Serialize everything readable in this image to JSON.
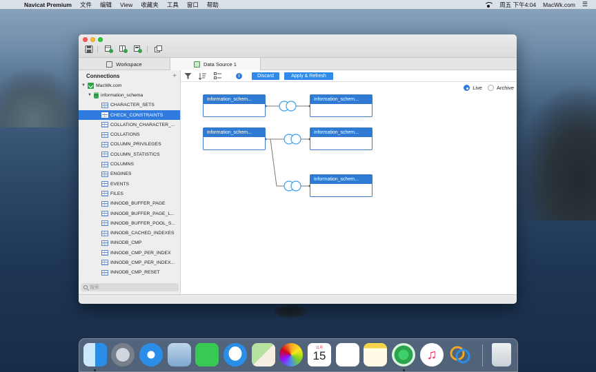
{
  "menubar": {
    "app_name": "Navicat Premium",
    "menus": [
      "文件",
      "编辑",
      "View",
      "收藏夹",
      "工具",
      "窗口",
      "帮助"
    ],
    "clock": "周五 下午4:04",
    "user": "MacWk.com"
  },
  "window": {
    "tabs": [
      {
        "label": "Workspace"
      },
      {
        "label": "Data Source 1"
      }
    ]
  },
  "sidebar": {
    "header": "Connections",
    "connection": "MacWk.com",
    "schema": "information_schema",
    "tables": [
      "CHARACTER_SETS",
      "CHECK_CONSTRAINTS",
      "COLLATION_CHARACTER_...",
      "COLLATIONS",
      "COLUMN_PRIVILEGES",
      "COLUMN_STATISTICS",
      "COLUMNS",
      "ENGINES",
      "EVENTS",
      "FILES",
      "INNODB_BUFFER_PAGE",
      "INNODB_BUFFER_PAGE_L...",
      "INNODB_BUFFER_POOL_S...",
      "INNODB_CACHED_INDEXES",
      "INNODB_CMP",
      "INNODB_CMP_PER_INDEX",
      "INNODB_CMP_PER_INDEX...",
      "INNODB_CMP_RESET"
    ],
    "selected_index": 1,
    "search_placeholder": "搜索"
  },
  "toolbar": {
    "discard_label": "Discard",
    "apply_label": "Apply & Refresh",
    "info_label": "i"
  },
  "mode": {
    "live_label": "Live",
    "archive_label": "Archive",
    "selected": "Live"
  },
  "diagram": {
    "nodes": [
      {
        "label": "information_schem..."
      },
      {
        "label": "information_schem..."
      },
      {
        "label": "information_schem..."
      },
      {
        "label": "information_schem..."
      },
      {
        "label": "information_schem..."
      }
    ]
  },
  "dock": {
    "calendar_month": "11月",
    "calendar_day": "15",
    "music_glyph": "♫"
  }
}
